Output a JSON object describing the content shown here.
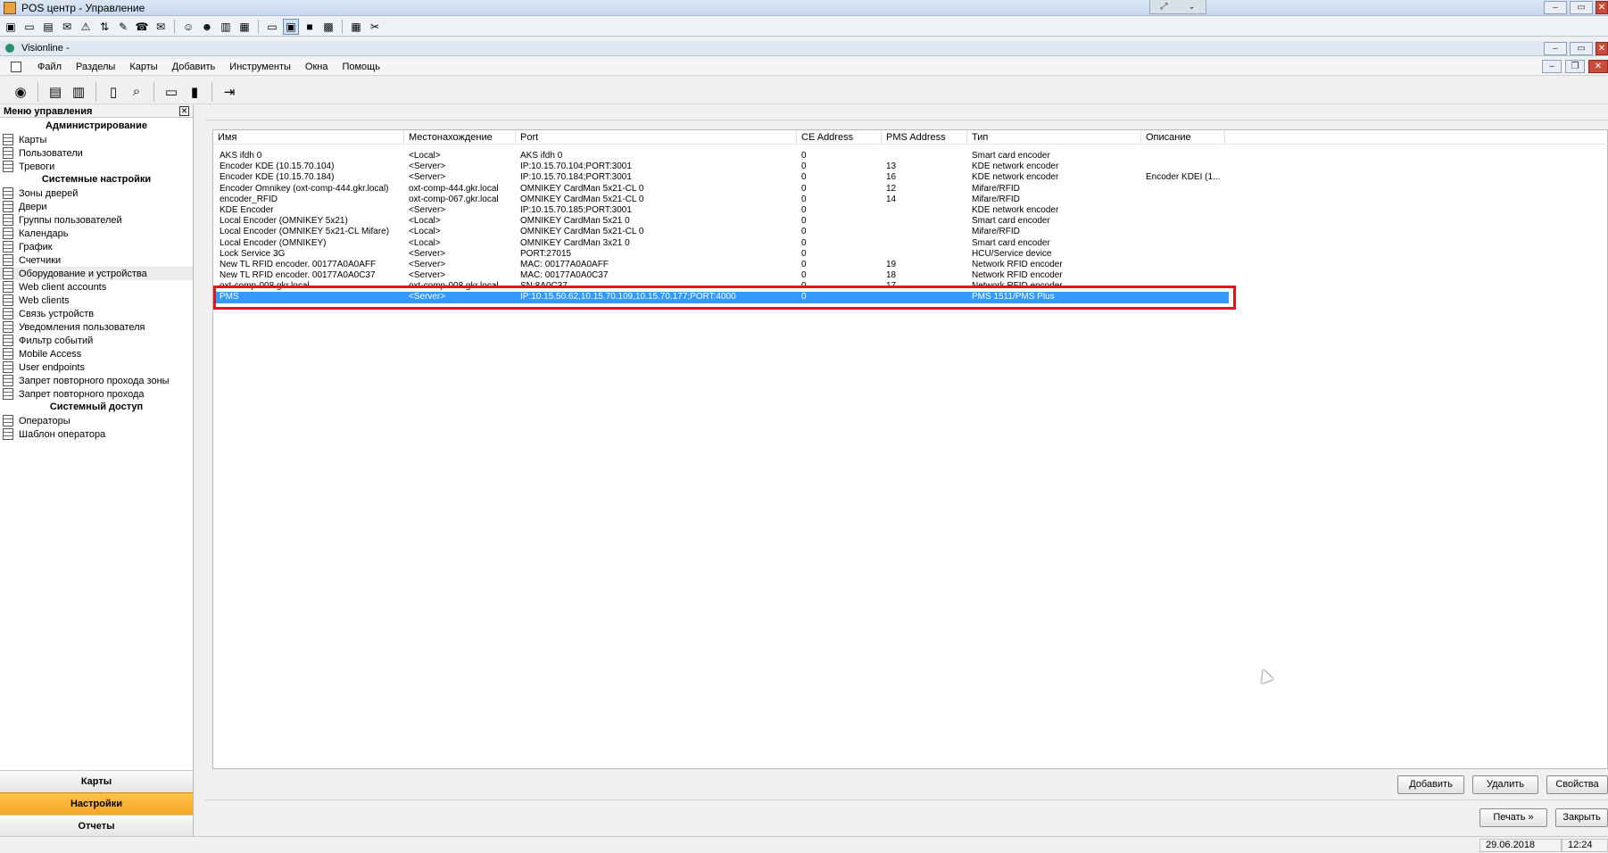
{
  "window": {
    "title": "POS центр - Управление"
  },
  "inner_window": {
    "title": "Visionline -"
  },
  "menu": [
    "Файл",
    "Разделы",
    "Карты",
    "Добавить",
    "Инструменты",
    "Окна",
    "Помощь"
  ],
  "nav": {
    "header": "Меню управления",
    "sections": [
      {
        "title": "Администрирование",
        "items": [
          "Карты",
          "Пользователи",
          "Тревоги"
        ]
      },
      {
        "title": "Системные настройки",
        "items": [
          "Зоны дверей",
          "Двери",
          "Группы пользователей",
          "Календарь",
          "График",
          "Счетчики",
          "Оборудование и устройства",
          "Web client accounts",
          "Web clients",
          "Связь устройств",
          "Уведомления пользователя",
          "Фильтр событий",
          "Mobile Access",
          "User endpoints",
          "Запрет повторного прохода зоны",
          "Запрет повторного прохода"
        ]
      },
      {
        "title": "Системный доступ",
        "items": [
          "Операторы",
          "Шаблон оператора"
        ]
      }
    ],
    "selected_item": "Оборудование и устройства",
    "tabs": [
      "Карты",
      "Настройки",
      "Отчеты"
    ],
    "active_tab": "Настройки"
  },
  "grid": {
    "columns": [
      "Имя",
      "Местонахождение",
      "Port",
      "CE Address",
      "PMS Address",
      "Тип",
      "Описание"
    ],
    "rows": [
      [
        "AKS ifdh 0",
        "<Local>",
        "AKS ifdh 0",
        "0",
        "",
        "Smart card encoder",
        ""
      ],
      [
        "Encoder KDE (10.15.70.104)",
        "<Server>",
        "IP:10.15.70.104;PORT:3001",
        "0",
        "13",
        "KDE network encoder",
        ""
      ],
      [
        "Encoder KDE (10.15.70.184)",
        "<Server>",
        "IP:10.15.70.184;PORT:3001",
        "0",
        "16",
        "KDE network encoder",
        "Encoder KDEI (1..."
      ],
      [
        "Encoder Omnikey (oxt-comp-444.gkr.local)",
        "oxt-comp-444.gkr.local",
        "OMNIKEY CardMan 5x21-CL 0",
        "0",
        "12",
        "Mifare/RFID",
        ""
      ],
      [
        "encoder_RFID",
        "oxt-comp-067.gkr.local",
        "OMNIKEY CardMan 5x21-CL 0",
        "0",
        "14",
        "Mifare/RFID",
        ""
      ],
      [
        "KDE Encoder",
        "<Server>",
        "IP:10.15.70.185;PORT:3001",
        "0",
        "",
        "KDE network encoder",
        ""
      ],
      [
        "Local Encoder (OMNIKEY 5x21)",
        "<Local>",
        "OMNIKEY CardMan 5x21 0",
        "0",
        "",
        "Smart card encoder",
        ""
      ],
      [
        "Local Encoder (OMNIKEY 5x21-CL Mifare)",
        "<Local>",
        "OMNIKEY CardMan 5x21-CL 0",
        "0",
        "",
        "Mifare/RFID",
        ""
      ],
      [
        "Local Encoder (OMNIKEY)",
        "<Local>",
        "OMNIKEY CardMan 3x21 0",
        "0",
        "",
        "Smart card encoder",
        ""
      ],
      [
        "Lock Service 3G",
        "<Server>",
        "PORT:27015",
        "0",
        "",
        "HCU/Service device",
        ""
      ],
      [
        "New TL RFID encoder. 00177A0A0AFF",
        "<Server>",
        "MAC: 00177A0A0AFF",
        "0",
        "19",
        "Network RFID encoder",
        ""
      ],
      [
        "New TL RFID encoder. 00177A0A0C37",
        "<Server>",
        "MAC: 00177A0A0C37",
        "0",
        "18",
        "Network RFID encoder",
        ""
      ],
      [
        "oxt-comp-008.gkr.local",
        "oxt-comp-008.gkr.local",
        "SN:8A0C37",
        "0",
        "17",
        "Network RFID encoder",
        ""
      ],
      [
        "PMS",
        "<Server>",
        "IP:10.15.50.62,10.15.70.109,10.15.70.177;PORT:4000",
        "0",
        "",
        "PMS 1511/PMS Plus",
        ""
      ]
    ],
    "selected_row": 13
  },
  "buttons": {
    "add": "Добавить",
    "delete": "Удалить",
    "properties": "Свойства",
    "print": "Печать »",
    "close": "Закрыть"
  },
  "status": {
    "date": "29.06.2018",
    "time": "12:24"
  },
  "colors": {
    "accent": "#f5a623",
    "selection": "#3399ff",
    "highlight_outline": "#e8131a"
  }
}
